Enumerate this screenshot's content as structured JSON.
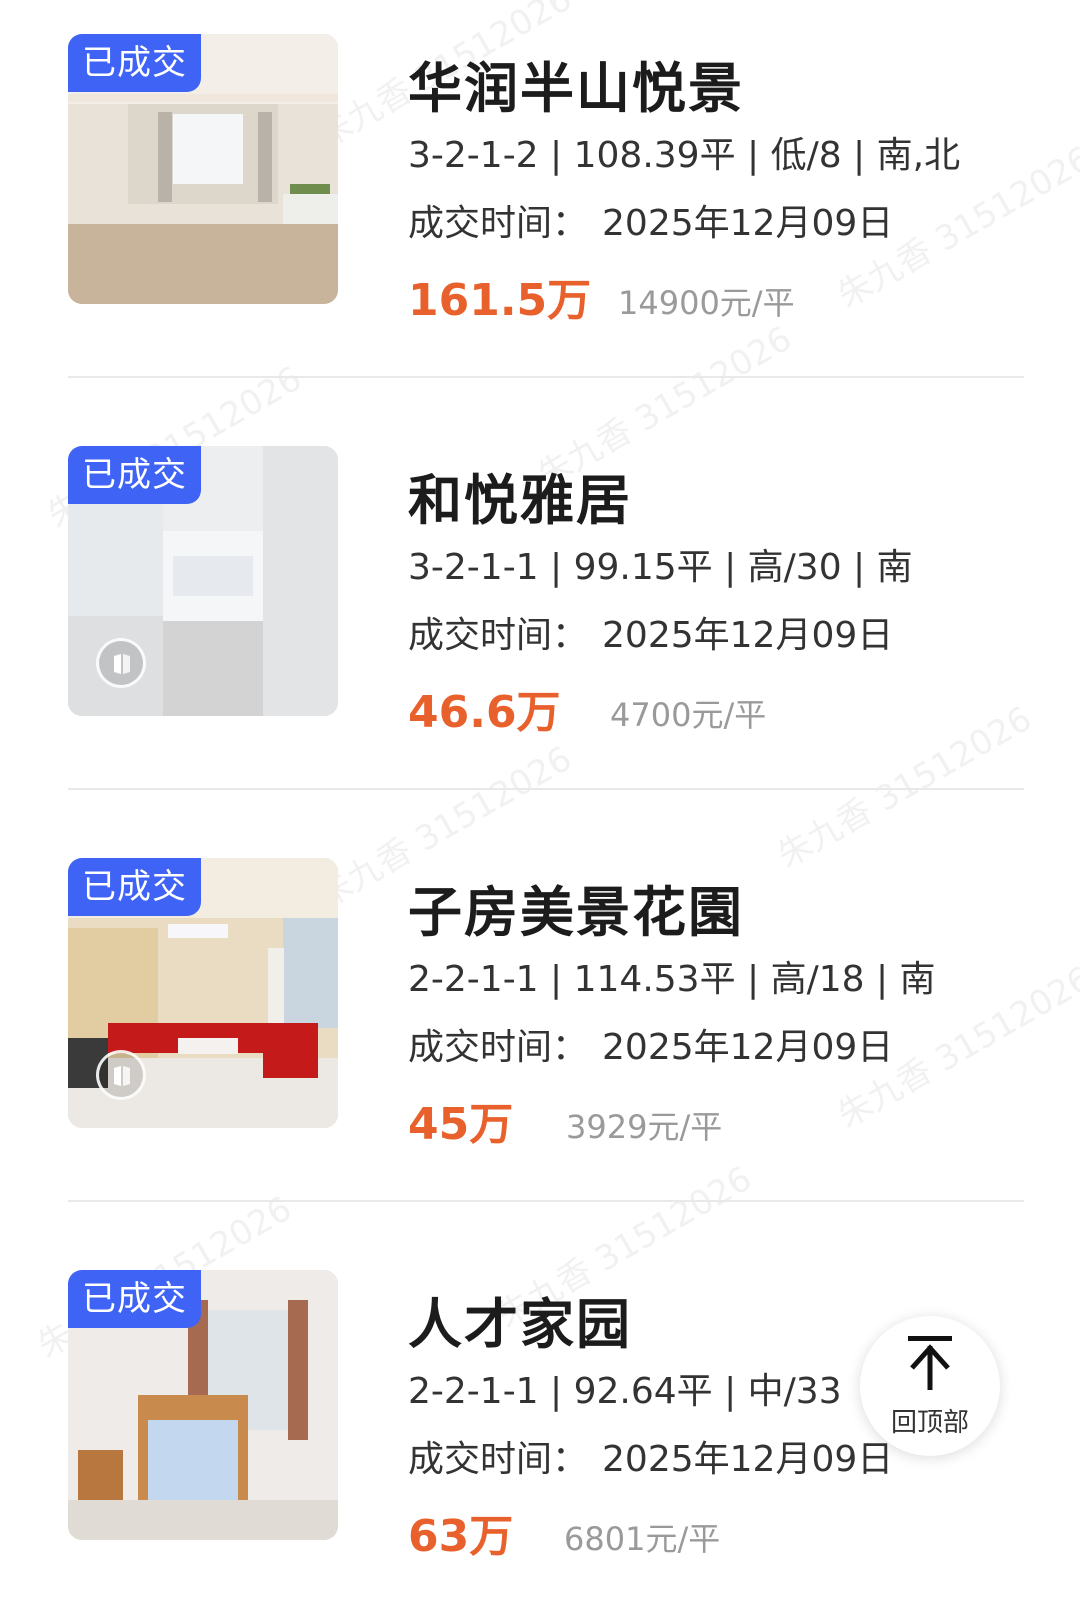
{
  "listings": [
    {
      "badge": "已成交",
      "title": "华润半山悦景",
      "spec": "3-2-1-2 | 108.39平 | 低/8 | 南,北",
      "deal_time_label": "成交时间：",
      "deal_time": "2025年12月09日",
      "price": "161.5万",
      "unit_price": "14900元/平",
      "has_vr": false
    },
    {
      "badge": "已成交",
      "title": "和悦雅居",
      "spec": "3-2-1-1 | 99.15平 | 高/30 | 南",
      "deal_time_label": "成交时间：",
      "deal_time": "2025年12月09日",
      "price": "46.6万",
      "unit_price": "4700元/平",
      "has_vr": true
    },
    {
      "badge": "已成交",
      "title": "子房美景花園",
      "spec": "2-2-1-1 | 114.53平 | 高/18 | 南",
      "deal_time_label": "成交时间：",
      "deal_time": "2025年12月09日",
      "price": "45万",
      "unit_price": "3929元/平",
      "has_vr": true
    },
    {
      "badge": "已成交",
      "title": "人才家园",
      "spec": "2-2-1-1 | 92.64平 | 中/33",
      "deal_time_label": "成交时间：",
      "deal_time": "2025年12月09日",
      "price": "63万",
      "unit_price": "6801元/平",
      "has_vr": false
    }
  ],
  "back_to_top": {
    "label": "回顶部",
    "icon": "arrow-up-to-top-icon"
  },
  "watermark": {
    "name": "朱九香",
    "id": "31512026"
  },
  "colors": {
    "badge": "#3f63f5",
    "price": "#e8612c",
    "unit_price": "#9a9a9a"
  }
}
